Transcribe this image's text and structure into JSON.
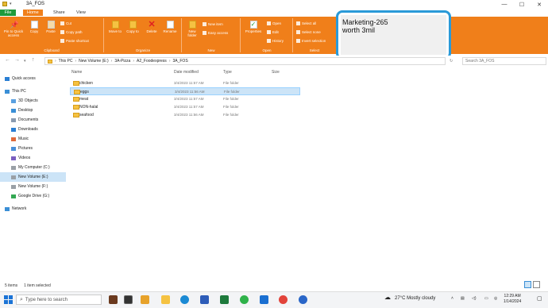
{
  "window": {
    "title": "3A_FOS",
    "controls": [
      "—",
      "☐",
      "✕"
    ]
  },
  "tabs": [
    "File",
    "Home",
    "Share",
    "View"
  ],
  "ribbon": {
    "clipboard": {
      "pin_label": "Pin to Quick access",
      "copy_label": "Copy",
      "paste_label": "Paste",
      "cut_label": "Cut",
      "copy_path_label": "Copy path",
      "paste_shortcut_label": "Paste shortcut",
      "group_label": "Clipboard"
    },
    "organize": {
      "move_label": "Move to",
      "copy_to_label": "Copy to",
      "delete_label": "Delete",
      "rename_label": "Rename",
      "group_label": "Organize"
    },
    "new": {
      "new_folder_label": "New folder",
      "new_item_label": "New item",
      "easy_access_label": "Easy access",
      "group_label": "New"
    },
    "open": {
      "properties_label": "Properties",
      "open_label": "Open",
      "edit_label": "Edit",
      "history_label": "History",
      "group_label": "Open"
    },
    "select": {
      "select_all_label": "Select all",
      "select_none_label": "Select none",
      "invert_label": "Invert selection",
      "group_label": "Select"
    }
  },
  "address": {
    "breadcrumb": [
      "This PC",
      "New Volume (E:)",
      "3A-Pizza",
      "A2_Foodexpress",
      "3A_FOS"
    ],
    "search_placeholder": "Search 3A_FOS"
  },
  "sidebar": {
    "items": [
      {
        "label": "Quick access",
        "icon": "star-icon",
        "selected": false,
        "indent": 0
      },
      {
        "label": "This PC",
        "icon": "pc-icon",
        "selected": false,
        "indent": 0
      },
      {
        "label": "3D Objects",
        "icon": "cube-icon",
        "selected": false,
        "indent": 1
      },
      {
        "label": "Desktop",
        "icon": "desktop-icon",
        "selected": false,
        "indent": 1
      },
      {
        "label": "Documents",
        "icon": "documents-icon",
        "selected": false,
        "indent": 1
      },
      {
        "label": "Downloads",
        "icon": "download-icon",
        "selected": false,
        "indent": 1
      },
      {
        "label": "Music",
        "icon": "music-icon",
        "selected": false,
        "indent": 1
      },
      {
        "label": "Pictures",
        "icon": "pictures-icon",
        "selected": false,
        "indent": 1
      },
      {
        "label": "Videos",
        "icon": "videos-icon",
        "selected": false,
        "indent": 1
      },
      {
        "label": "My Computer (C:)",
        "icon": "drive-icon",
        "selected": false,
        "indent": 1
      },
      {
        "label": "New Volume (E:)",
        "icon": "drive-icon",
        "selected": true,
        "indent": 1
      },
      {
        "label": "New Volume (F:)",
        "icon": "drive-icon",
        "selected": false,
        "indent": 1
      },
      {
        "label": "Google Drive (G:)",
        "icon": "google-drive-icon",
        "selected": false,
        "indent": 1
      },
      {
        "label": "Network",
        "icon": "network-icon",
        "selected": false,
        "indent": 0
      }
    ]
  },
  "columns": [
    "Name",
    "Date modified",
    "Type",
    "Size"
  ],
  "files": [
    {
      "name": "chicken",
      "date": "3/4/2023 11:57 AM",
      "type": "File folder",
      "selected": false
    },
    {
      "name": "eggs",
      "date": "3/4/2023 11:56 AM",
      "type": "File folder",
      "selected": true
    },
    {
      "name": "meat",
      "date": "3/4/2023 11:57 AM",
      "type": "File folder",
      "selected": false
    },
    {
      "name": "NON-halal",
      "date": "3/4/2023 11:57 AM",
      "type": "File folder",
      "selected": false
    },
    {
      "name": "seafood",
      "date": "3/4/2023 11:56 AM",
      "type": "File folder",
      "selected": false
    }
  ],
  "status": {
    "items_count": "5 items",
    "selected_count": "1 item selected"
  },
  "note": {
    "line1": "Marketing-265",
    "line2": "worth 3mil"
  },
  "taskbar": {
    "search_placeholder": "Type here to search",
    "weather": "27°C  Mostly cloudy",
    "time": "12:29 AM",
    "date": "1/14/2024"
  },
  "colors": {
    "ribbon": "#f07f1a",
    "file_tab": "#1e9b3d",
    "selection": "#cce4f7",
    "note_border": "#2a9ad8"
  }
}
